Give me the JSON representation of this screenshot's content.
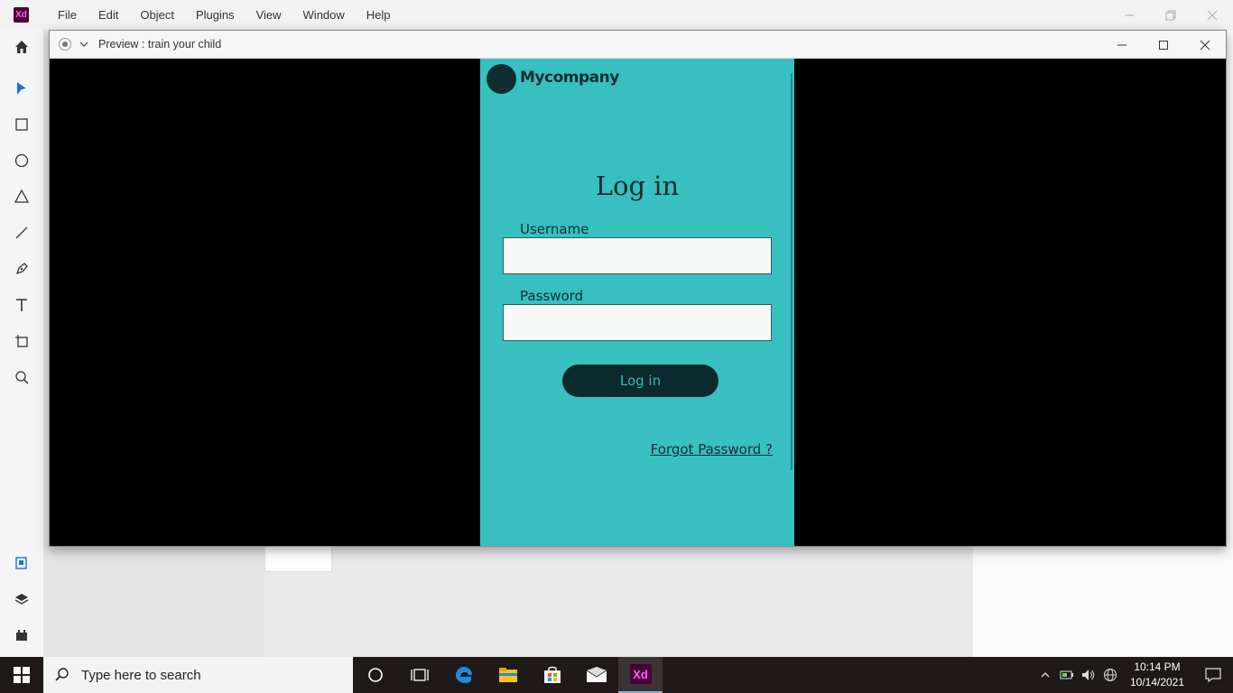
{
  "app": {
    "logo_text": "Xd",
    "accent": "#470137"
  },
  "menu": [
    "File",
    "Edit",
    "Object",
    "Plugins",
    "View",
    "Window",
    "Help"
  ],
  "toolbar": {
    "tools": [
      "home-icon",
      "select-icon",
      "rectangle-icon",
      "ellipse-icon",
      "triangle-icon",
      "line-icon",
      "pen-icon",
      "text-icon",
      "artboard-icon",
      "zoom-icon",
      "document-assets-icon",
      "layers-icon",
      "plugins-icon"
    ]
  },
  "preview": {
    "title": "Preview : train your child",
    "artboard": {
      "bg_color": "#38bfc0",
      "brand_name": "Mycompany",
      "heading": "Log in",
      "username_label": "Username",
      "password_label": "Password",
      "username_value": "",
      "password_value": "",
      "button_label": "Log in",
      "forgot_link": "Forgot Password ?"
    }
  },
  "taskbar": {
    "search_placeholder": "Type here to search",
    "time": "10:14 PM",
    "date": "10/14/2021",
    "xd_label": "Xd"
  }
}
